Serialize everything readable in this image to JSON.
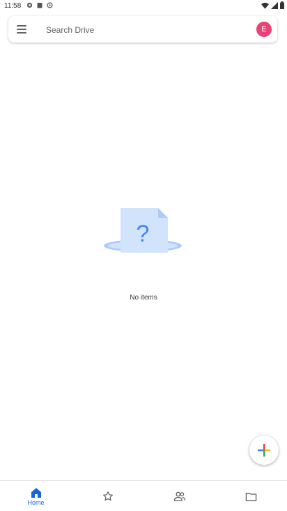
{
  "status_bar": {
    "time": "11:58"
  },
  "search": {
    "placeholder": "Search Drive",
    "value": ""
  },
  "account": {
    "avatar_letter": "E",
    "avatar_color": "#e84278"
  },
  "empty_state": {
    "message": "No items",
    "icon": "question-mark-document"
  },
  "fab": {
    "icon": "plus-icon"
  },
  "bottom_nav": {
    "items": [
      {
        "label": "Home",
        "icon": "home-icon",
        "selected": true
      },
      {
        "label": "",
        "icon": "star-icon",
        "selected": false
      },
      {
        "label": "",
        "icon": "shared-people-icon",
        "selected": false
      },
      {
        "label": "",
        "icon": "folder-icon",
        "selected": false
      }
    ],
    "accent_color": "#1967d2"
  }
}
